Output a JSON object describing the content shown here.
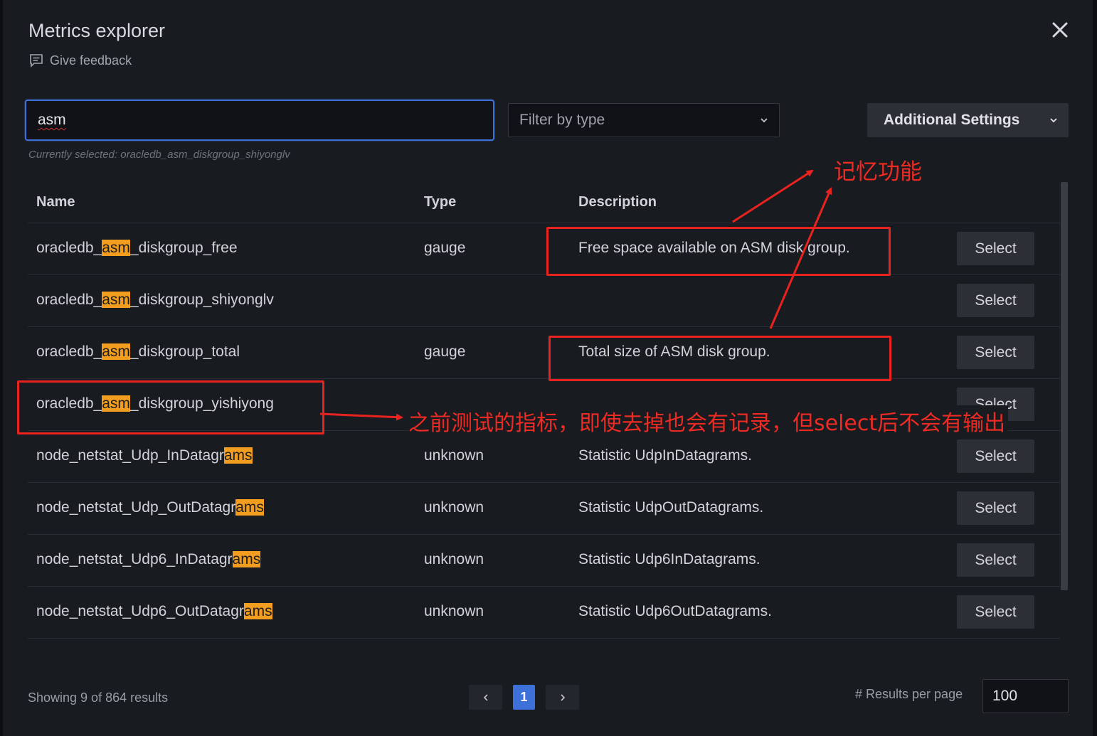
{
  "modal": {
    "title": "Metrics explorer",
    "feedback_label": "Give feedback"
  },
  "search": {
    "value": "asm"
  },
  "filter": {
    "placeholder": "Filter by type"
  },
  "additional_settings": {
    "label": "Additional Settings"
  },
  "currently_selected": "Currently selected: oracledb_asm_diskgroup_shiyonglv",
  "table": {
    "columns": [
      "Name",
      "Type",
      "Description"
    ],
    "select_label": "Select",
    "rows": [
      {
        "name_pre": "oracledb_",
        "name_hl": "asm",
        "name_post": "_diskgroup_free",
        "type": "gauge",
        "description": "Free space available on ASM disk group."
      },
      {
        "name_pre": "oracledb_",
        "name_hl": "asm",
        "name_post": "_diskgroup_shiyonglv",
        "type": "",
        "description": ""
      },
      {
        "name_pre": "oracledb_",
        "name_hl": "asm",
        "name_post": "_diskgroup_total",
        "type": "gauge",
        "description": "Total size of ASM disk group."
      },
      {
        "name_pre": "oracledb_",
        "name_hl": "asm",
        "name_post": "_diskgroup_yishiyong",
        "type": "",
        "description": ""
      },
      {
        "name_pre": "node_netstat_Udp_InDatagr",
        "name_hl": "ams",
        "name_post": "",
        "type": "unknown",
        "description": "Statistic UdpInDatagrams."
      },
      {
        "name_pre": "node_netstat_Udp_OutDatagr",
        "name_hl": "ams",
        "name_post": "",
        "type": "unknown",
        "description": "Statistic UdpOutDatagrams."
      },
      {
        "name_pre": "node_netstat_Udp6_InDatagr",
        "name_hl": "ams",
        "name_post": "",
        "type": "unknown",
        "description": "Statistic Udp6InDatagrams."
      },
      {
        "name_pre": "node_netstat_Udp6_OutDatagr",
        "name_hl": "ams",
        "name_post": "",
        "type": "unknown",
        "description": "Statistic Udp6OutDatagrams."
      }
    ]
  },
  "footer": {
    "showing": "Showing 9 of 864 results",
    "current_page": "1",
    "results_per_page_label": "# Results per page",
    "results_per_page_value": "100"
  },
  "annotations": {
    "memory_label": "记忆功能",
    "note_label": "之前测试的指标，即使去掉也会有记录，但select后不会有输出"
  },
  "colors": {
    "highlight": "#f29d1f",
    "annotation": "#e8231f",
    "accent": "#3d71d9"
  }
}
